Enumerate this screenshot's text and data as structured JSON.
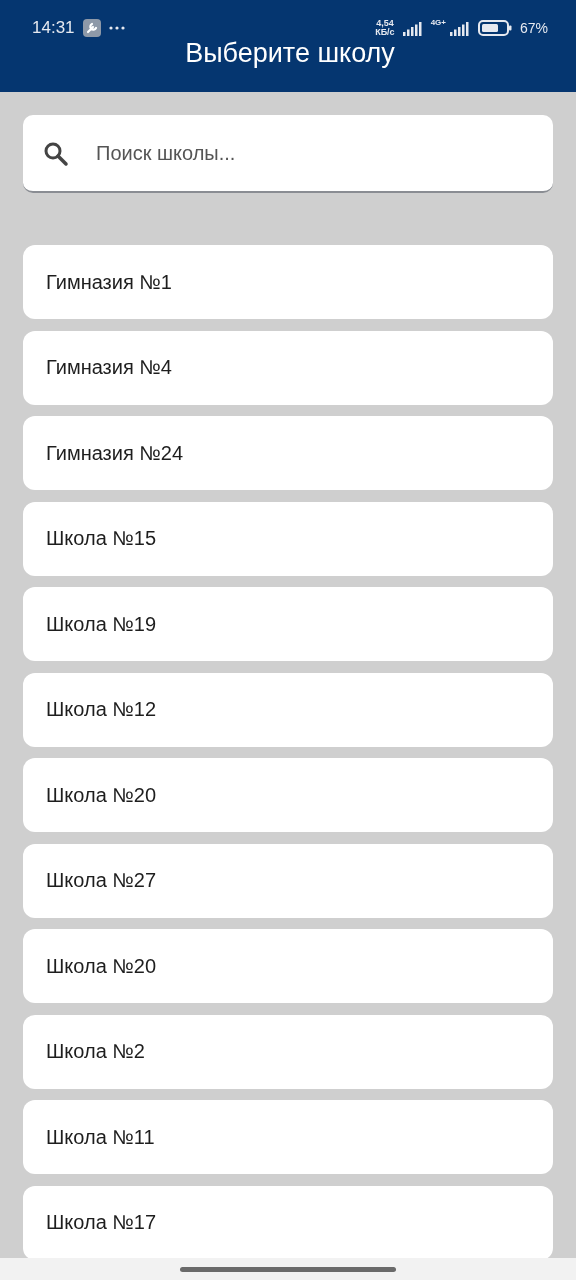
{
  "status_bar": {
    "time": "14:31",
    "speed": "4,54\nКБ/с",
    "network": "4G+",
    "battery": "67%"
  },
  "header": {
    "title": "Выберите школу"
  },
  "search": {
    "placeholder": "Поиск школы..."
  },
  "schools": [
    {
      "name": "Гимназия №1"
    },
    {
      "name": "Гимназия №4"
    },
    {
      "name": "Гимназия №24"
    },
    {
      "name": "Школа №15"
    },
    {
      "name": "Школа №19"
    },
    {
      "name": "Школа №12"
    },
    {
      "name": "Школа №20"
    },
    {
      "name": "Школа №27"
    },
    {
      "name": "Школа №20"
    },
    {
      "name": "Школа №2"
    },
    {
      "name": "Школа №11"
    },
    {
      "name": "Школа №17"
    }
  ]
}
